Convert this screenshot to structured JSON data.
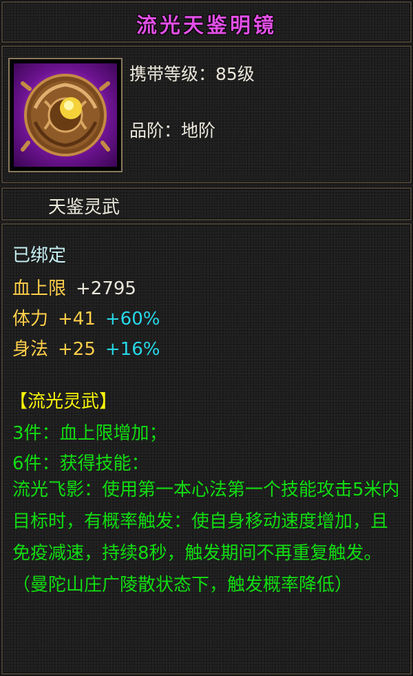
{
  "item": {
    "name": "流光天鉴明镜",
    "carry_level": "携带等级：85级",
    "grade": "品阶：地阶",
    "set_name": "天鉴灵武",
    "icon": "bronze-compass-orb-icon"
  },
  "attributes": {
    "bound": "已绑定",
    "hp": {
      "label": "血上限",
      "value": "+2795"
    },
    "stamina": {
      "label": "体力",
      "value": "+41",
      "bonus": "+60%"
    },
    "agility": {
      "label": "身法",
      "value": "+25",
      "bonus": "+16%"
    }
  },
  "set_effect": {
    "title": "【流光灵武】",
    "piece3": "3件：血上限增加；",
    "piece6": "6件：获得技能：",
    "description": "流光飞影：使用第一本心法第一个技能攻击5米内目标时，有概率触发：使自身移动速度增加，且免疫减速，持续8秒，触发期间不再重复触发。（曼陀山庄广陵散状态下，触发概率降低）"
  },
  "colors": {
    "name": "#e24fe6",
    "bound": "#c7f1f4",
    "stat_label": "#ffcf4a",
    "bonus": "#27d8e8",
    "set_title": "#f6f30a",
    "set_text": "#12dc12"
  }
}
